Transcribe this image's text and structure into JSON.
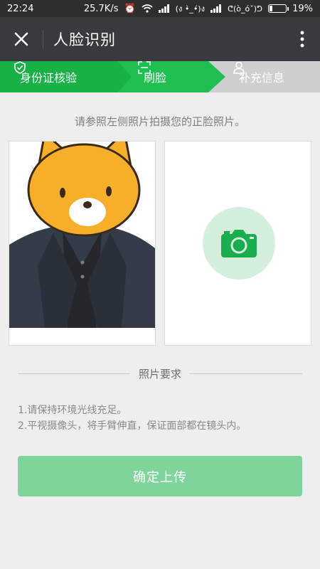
{
  "status_bar": {
    "time": "22:24",
    "net_speed": "25.7K/s",
    "emoticon_1": "(ง •̀_•́)ง",
    "emoticon_2": "ᕦ(ò_óˇ)ᕤ",
    "battery": "19%",
    "battery_level": 0.19
  },
  "app_bar": {
    "title": "人脸识别",
    "close_icon": "close-icon",
    "more_icon": "more-vertical-icon"
  },
  "steps": [
    {
      "label": "身份证核验",
      "icon": "shield-icon",
      "state": "done"
    },
    {
      "label": "刷脸",
      "icon": "face-scan-icon",
      "state": "active"
    },
    {
      "label": "补充信息",
      "icon": "user-icon",
      "state": "pending"
    }
  ],
  "instruction": "请参照左侧照片拍摄您的正脸照片。",
  "photo_requirements": {
    "title": "照片要求",
    "items": [
      "1.请保持环境光线充足。",
      "2.平视摄像头，将手臂伸直，保证面部都在镜头内。"
    ]
  },
  "confirm_button": "确定上传",
  "colors": {
    "appbar": "#393a3f",
    "step_green": "#1fbf52",
    "step_inactive": "#cfcfcf",
    "button": "#7ed49b",
    "camera_green": "#1aad4d"
  }
}
